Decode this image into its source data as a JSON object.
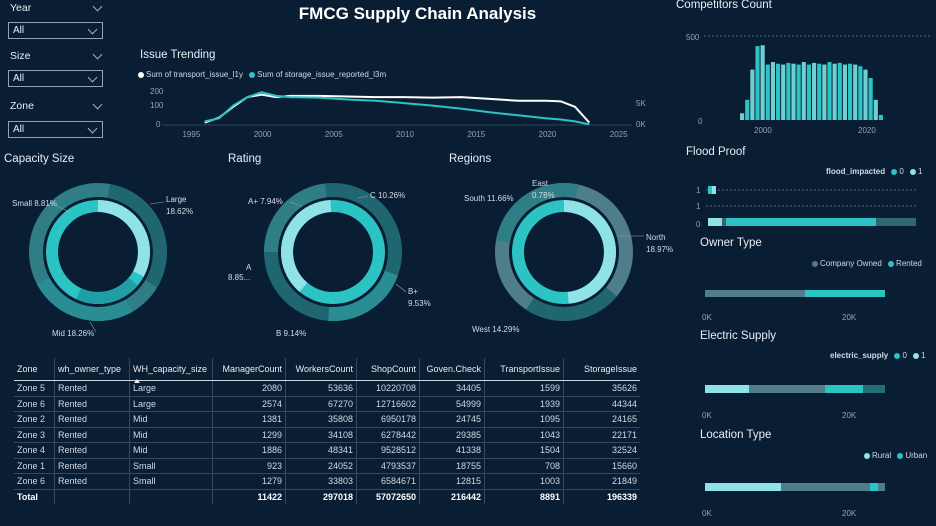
{
  "title": "FMCG Supply Chain Analysis",
  "colors": {
    "bg": "#0a1e33",
    "teal_light": "#8fe3e6",
    "teal": "#2cc3c5",
    "teal_mid": "#1f9fa3",
    "teal_dark": "#236f76",
    "grey": "#4f6c7c",
    "white": "#ffffff"
  },
  "slicers": [
    {
      "label": "Year",
      "value": "All"
    },
    {
      "label": "Size",
      "value": "All"
    },
    {
      "label": "Zone",
      "value": "All"
    }
  ],
  "issue_trending": {
    "title": "Issue Trending",
    "legend": [
      "Sum of transport_issue_l1y",
      "Sum of storage_issue_reported_l3m"
    ],
    "x_ticks": [
      "1995",
      "2000",
      "2005",
      "2010",
      "2015",
      "2020",
      "2025"
    ],
    "y_left_ticks": [
      "200",
      "100",
      "0"
    ],
    "y_right_ticks": [
      "5K",
      "0K"
    ],
    "chart_data": {
      "type": "line",
      "x": [
        1996,
        1997,
        1998,
        1999,
        2000,
        2001,
        2002,
        2004,
        2006,
        2008,
        2010,
        2012,
        2014,
        2016,
        2018,
        2020,
        2021,
        2022,
        2023
      ],
      "series": [
        {
          "name": "Sum of transport_issue_l1y",
          "values": [
            20,
            60,
            150,
            230,
            250,
            230,
            240,
            240,
            235,
            230,
            230,
            225,
            230,
            215,
            200,
            200,
            195,
            150,
            20
          ]
        },
        {
          "name": "Sum of storage_issue_reported_l3m",
          "values": [
            30,
            55,
            160,
            230,
            270,
            240,
            230,
            225,
            210,
            200,
            180,
            160,
            135,
            105,
            80,
            55,
            45,
            30,
            5
          ]
        }
      ]
    }
  },
  "competitors": {
    "title": "Competitors Count",
    "y_ticks": [
      "500",
      "0"
    ],
    "x_ticks": [
      "2000",
      "2020"
    ],
    "chart_data": {
      "type": "bar",
      "x_range": [
        1996,
        2023
      ],
      "values": [
        40,
        120,
        300,
        440,
        445,
        330,
        345,
        335,
        330,
        340,
        335,
        330,
        345,
        330,
        340,
        335,
        330,
        345,
        335,
        340,
        330,
        335,
        330,
        320,
        300,
        250,
        120,
        30
      ]
    }
  },
  "capacity": {
    "title": "Capacity Size",
    "labels": [
      "Small 8.81%",
      "Large",
      "18.62%",
      "Mid 18.26%"
    ]
  },
  "rating": {
    "title": "Rating",
    "labels": [
      "A+ 7.94%",
      "C 10.26%",
      "A",
      "8.85...",
      "B+",
      "9.53%",
      "B 9.14%"
    ]
  },
  "regions": {
    "title": "Regions",
    "labels": [
      "East",
      "0.78%",
      "South 11.66%",
      "North",
      "18.97%",
      "West 14.29%"
    ]
  },
  "flood": {
    "title": "Flood Proof",
    "legend_title": "flood_impacted",
    "legend": [
      "0",
      "1"
    ],
    "y_ticks": [
      "1",
      "1",
      "0"
    ]
  },
  "owner": {
    "title": "Owner Type",
    "legend": [
      "Company Owned",
      "Rented"
    ],
    "ticks": [
      "0K",
      "20K"
    ]
  },
  "electric": {
    "title": "Electric Supply",
    "legend_title": "electric_supply",
    "legend": [
      "0",
      "1"
    ],
    "ticks": [
      "0K",
      "20K"
    ]
  },
  "location": {
    "title": "Location Type",
    "legend": [
      "Rural",
      "Urban"
    ],
    "ticks": [
      "0K",
      "20K"
    ]
  },
  "table": {
    "headers": [
      "Zone",
      "wh_owner_type",
      "WH_capacity_size",
      "ManagerCount",
      "WorkersCount",
      "ShopCount",
      "Goven.Check",
      "TransportIssue",
      "StorageIssue"
    ],
    "rows": [
      [
        "Zone 5",
        "Rented",
        "Large",
        "2080",
        "53636",
        "10220708",
        "34405",
        "1599",
        "35626"
      ],
      [
        "Zone 6",
        "Rented",
        "Large",
        "2574",
        "67270",
        "12716602",
        "54999",
        "1939",
        "44344"
      ],
      [
        "Zone 2",
        "Rented",
        "Mid",
        "1381",
        "35808",
        "6950178",
        "24745",
        "1095",
        "24165"
      ],
      [
        "Zone 3",
        "Rented",
        "Mid",
        "1299",
        "34108",
        "6278442",
        "29385",
        "1043",
        "22171"
      ],
      [
        "Zone 4",
        "Rented",
        "Mid",
        "1886",
        "48341",
        "9528512",
        "41338",
        "1504",
        "32524"
      ],
      [
        "Zone 1",
        "Rented",
        "Small",
        "923",
        "24052",
        "4793537",
        "18755",
        "708",
        "15660"
      ],
      [
        "Zone 6",
        "Rented",
        "Small",
        "1279",
        "33803",
        "6584671",
        "12815",
        "1003",
        "21849"
      ]
    ],
    "total": [
      "Total",
      "",
      "",
      "11422",
      "297018",
      "57072650",
      "216442",
      "8891",
      "196339"
    ]
  }
}
